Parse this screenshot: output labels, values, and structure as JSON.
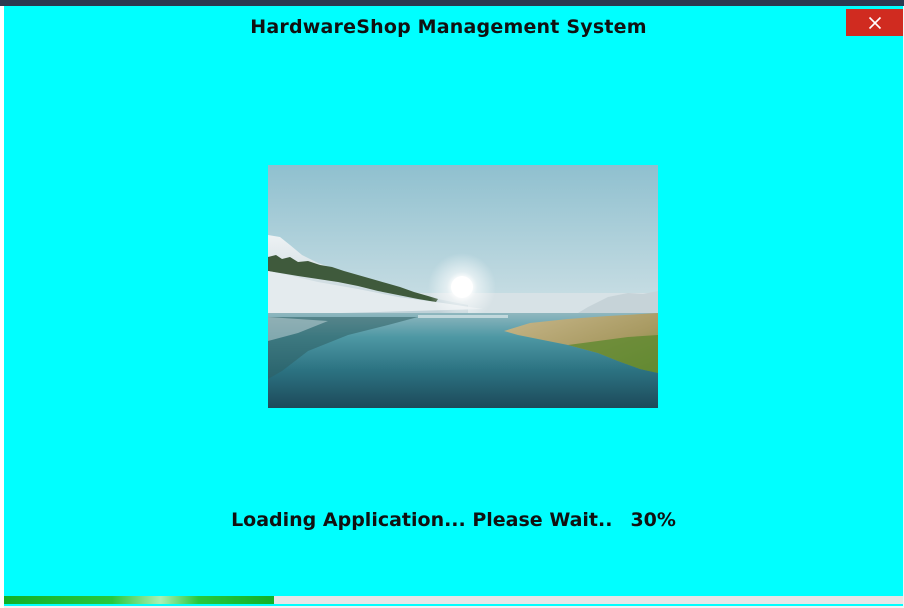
{
  "window": {
    "title": "HardwareShop Management System",
    "close_label": "✕"
  },
  "splash_image": {
    "icon": "landscape-lake-sunrise-image"
  },
  "loading": {
    "message": "Loading Application... Please Wait..",
    "percent_text": "30%",
    "progress": 0.3
  },
  "colors": {
    "background": "#00ffff",
    "close_button": "#d02b20",
    "progress_fill": "#11b028",
    "progress_track": "#e6e6e6"
  }
}
